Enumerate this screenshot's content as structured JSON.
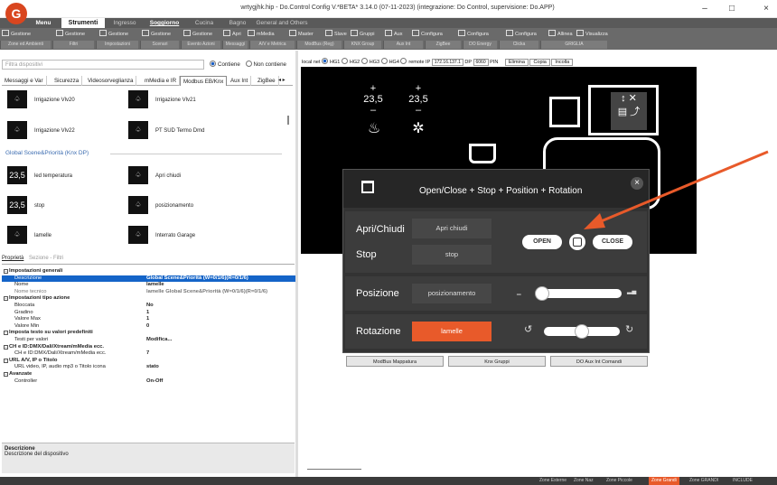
{
  "window": {
    "title": "wrtygjhk.hip - Do.Control Config V.*BETA* 3.14.0 (07-11-2023) (integrazione: Do Control, supervisione: Do.APP)",
    "logo": "G",
    "min": "–",
    "max": "□",
    "close": "×"
  },
  "menu": [
    {
      "label": "Menu"
    },
    {
      "label": "Strumenti"
    },
    {
      "label": "Ingresso"
    },
    {
      "label": "Soggiorno"
    },
    {
      "label": "Cucina"
    },
    {
      "label": "Bagno"
    },
    {
      "label": "General and Others"
    }
  ],
  "ribbon_top": [
    "Gestione",
    "Gestione",
    "Gestione",
    "Gestione",
    "Gestione",
    "Apri",
    "mMedia",
    "Master",
    "Slave",
    "Gruppi",
    "Aux",
    "Configura",
    "Configura",
    "Configura",
    "Allinea",
    "Visualizza"
  ],
  "ribbon_bottom": [
    "Zone ed Ambienti",
    "Filtri",
    "Impostazioni",
    "Scenari",
    "Evento Azioni",
    "Messaggi",
    "A/V e Metrica",
    "ModBus (Reg)",
    "KNX Group",
    "Aux Int",
    "ZigBee",
    "DO Energy",
    "Clicka",
    "GRIGLIA"
  ],
  "filter": {
    "placeholder": "Filtra dispositivi",
    "opt1": "Contiene",
    "opt2": "Non contiene"
  },
  "tabs": [
    "Messaggi e Var",
    "Sicurezza",
    "Videosorveglianza",
    "mMedia e IR",
    "Modbus EB/Knx",
    "Aux Int",
    "ZigBee"
  ],
  "devices": [
    {
      "label": "Irrigazione Vlv20"
    },
    {
      "label": "Irrigazione Vlv21"
    },
    {
      "label": "Irrigazione Vlv22"
    },
    {
      "label": "PT SUD Termo Dmd"
    }
  ],
  "group_title": "Global Scene&Priorità (Knx DP)",
  "group_devices": [
    {
      "icon": "23,5",
      "label": "led temperatura"
    },
    {
      "icon": "",
      "label": "Apri chiudi"
    },
    {
      "icon": "23,5",
      "label": "stop"
    },
    {
      "icon": "",
      "label": "posizionamento"
    },
    {
      "icon": "",
      "label": "lamelle"
    },
    {
      "icon": "",
      "label": "Interrato Garage"
    }
  ],
  "props_tabs": {
    "a": "Proprietà",
    "b": "Sezione - Filtri"
  },
  "props": [
    {
      "t": "hdr",
      "k": "Impostazioni generali",
      "v": ""
    },
    {
      "t": "sel",
      "k": "Descrizione",
      "v": "Global Scene&Priorità (W=0/1/6)(R=0/1/6)"
    },
    {
      "t": "",
      "k": "Nome",
      "v": "lamelle"
    },
    {
      "t": "dim",
      "k": "Nome tecnico",
      "v": "lamelle Global Scene&Priorità (W=0/1/6)(R=0/1/6)"
    },
    {
      "t": "hdr",
      "k": "Impostazioni tipo azione",
      "v": ""
    },
    {
      "t": "",
      "k": "Bloccata",
      "v": "No"
    },
    {
      "t": "",
      "k": "Gradino",
      "v": "1"
    },
    {
      "t": "",
      "k": "Valore Max",
      "v": "1"
    },
    {
      "t": "",
      "k": "Valore Min",
      "v": "0"
    },
    {
      "t": "hdr",
      "k": "Imposta testo su valori predefiniti",
      "v": ""
    },
    {
      "t": "",
      "k": "Testi per valori",
      "v": "Modifica..."
    },
    {
      "t": "hdr",
      "k": "CH e ID:DMX/Dali/Xtream/mMedia ecc.",
      "v": ""
    },
    {
      "t": "",
      "k": "CH e ID:DMX/Dali/Xtream/mMedia ecc.",
      "v": "7"
    },
    {
      "t": "hdr",
      "k": "URL A/V, IP o Titolo",
      "v": ""
    },
    {
      "t": "",
      "k": "URL video, IP, audio mp3 o Titolo icona",
      "v": "stato"
    },
    {
      "t": "hdr",
      "k": "Avanzate",
      "v": ""
    },
    {
      "t": "",
      "k": "Controller",
      "v": "On-Off"
    }
  ],
  "desc": {
    "title": "Descrizione",
    "text": "Descrizione del dispositivo"
  },
  "canvas_bar": {
    "local": "local net",
    "hg1": "HG1",
    "hg2": "HG2",
    "hg3": "HG3",
    "hg4": "HG4",
    "remote": "remote IP",
    "ip": "172.16.137.1",
    "dp": "DP",
    "port": "6060",
    "pin": "PIN",
    "elimina": "Elimina",
    "copia": "Copia",
    "incolla": "Incolla"
  },
  "canvas": {
    "t1": "23,5",
    "t2": "23,5"
  },
  "modal": {
    "title": "Open/Close + Stop + Position + Rotation",
    "rows": [
      {
        "label": "Apri/Chiudi",
        "value": "Apri chiudi"
      },
      {
        "label": "Stop",
        "value": "stop"
      },
      {
        "label": "Posizione",
        "value": "posizionamento"
      },
      {
        "label": "Rotazione",
        "value": "lamelle"
      }
    ],
    "open": "OPEN",
    "close": "CLOSE",
    "x": "×"
  },
  "bottom_buttons": [
    "ModBus Mappatura",
    "Knx Gruppi",
    "DO Aux Int Comandi"
  ],
  "status": [
    "Zone Esterne",
    "Zone Naz",
    "Zone Piccole",
    "Zone Grandi",
    "Zone GRANDI",
    "INCLUDE"
  ],
  "colors": {
    "accent": "#e85a2a",
    "dark": "#333333",
    "ribbon": "#6a6a6a"
  }
}
